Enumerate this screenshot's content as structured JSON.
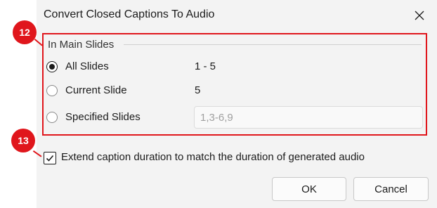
{
  "dialog": {
    "title": "Convert Closed Captions To Audio",
    "close_icon": "close-icon"
  },
  "slides_group": {
    "label": "In Main Slides",
    "options": [
      {
        "label": "All Slides",
        "value": "1 - 5",
        "checked": true
      },
      {
        "label": "Current Slide",
        "value": "5",
        "checked": false
      },
      {
        "label": "Specified Slides",
        "placeholder": "1,3-6,9",
        "checked": false
      }
    ]
  },
  "extend_option": {
    "label": "Extend caption duration to match the duration of generated audio",
    "checked": true
  },
  "buttons": {
    "ok": "OK",
    "cancel": "Cancel"
  },
  "callouts": {
    "first": "12",
    "second": "13"
  },
  "colors": {
    "accent": "#e0161c",
    "dialog_bg": "#f3f3f3"
  }
}
